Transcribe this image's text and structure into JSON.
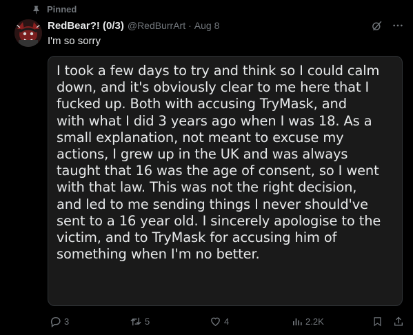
{
  "pinned_label": "Pinned",
  "author": {
    "name": "RedBear?! (0/3)",
    "handle": "@RedBurrArt",
    "separator": "·",
    "date": "Aug 8"
  },
  "tweet_text": "I'm so sorry",
  "image_text": "I took a few days to try and think so I could calm\ndown, and it's obviously clear to me here that I\nfucked up. Both with accusing TryMask, and\nwith what I did 3 years ago when I was 18. As a\nsmall explanation, not meant to excuse my\nactions, I grew up in the UK and was always\ntaught that 16 was the age of consent, so I went\nwith that law. This was not the right decision,\nand led to me sending things I never should've\nsent to a 16 year old. I sincerely apologise to the\nvictim, and to TryMask for accusing him of\nsomething when I'm no better.",
  "actions": {
    "replies": "3",
    "reposts": "5",
    "likes": "4",
    "views": "2.2K"
  },
  "colors": {
    "background": "#000000",
    "text": "#e7e9ea",
    "muted": "#71767b",
    "card": "#1a1a1a"
  }
}
